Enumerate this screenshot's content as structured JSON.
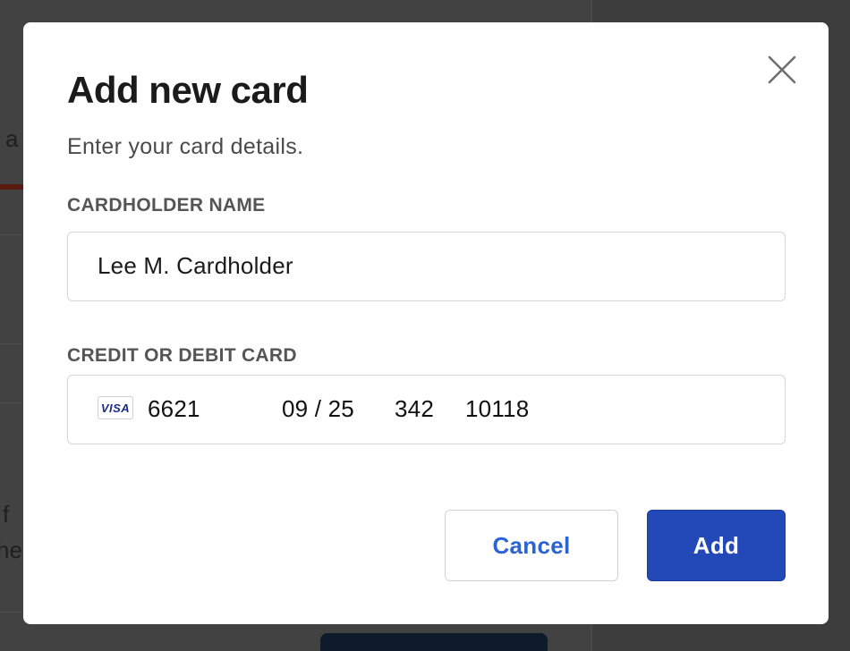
{
  "background": {
    "fragment_1": "a",
    "fragment_2": "l f",
    "fragment_3": "he"
  },
  "modal": {
    "title": "Add new card",
    "subtitle": "Enter your card details.",
    "close_icon": "close-icon",
    "cardholder": {
      "label": "CARDHOLDER NAME",
      "value": "Lee M. Cardholder"
    },
    "card": {
      "label": "CREDIT OR DEBIT CARD",
      "brand": "VISA",
      "brand_icon": "visa-icon",
      "number": "6621",
      "expiry": "09 / 25",
      "cvc": "342",
      "zip": "10118"
    },
    "buttons": {
      "cancel": "Cancel",
      "add": "Add"
    }
  },
  "colors": {
    "primary": "#2348b8",
    "link": "#2a63d4",
    "overlay": "#3d3d3d"
  }
}
